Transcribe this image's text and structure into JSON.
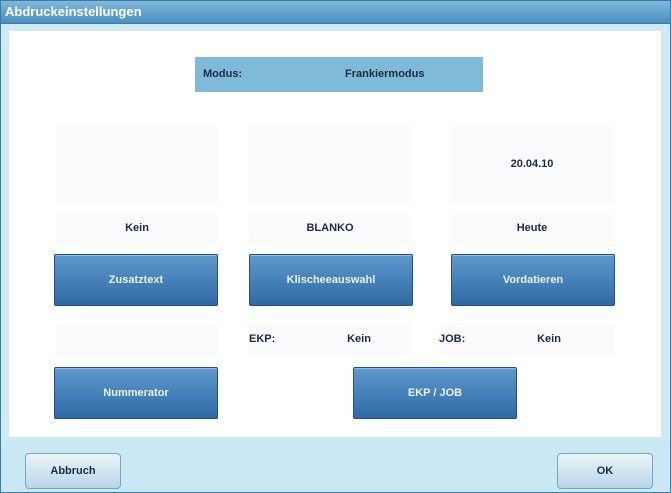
{
  "window": {
    "title": "Abdruckeinstellungen"
  },
  "modus": {
    "label": "Modus:",
    "value": "Frankiermodus"
  },
  "columns": [
    {
      "preview": "",
      "value": "Kein",
      "button": "Zusatztext"
    },
    {
      "preview": "",
      "value": "BLANKO",
      "button": "Klischeeauswahl"
    },
    {
      "preview": "20.04.10",
      "value": "Heute",
      "button": "Vordatieren"
    }
  ],
  "ekp": {
    "label": "EKP:",
    "value": "Kein"
  },
  "job": {
    "label": "JOB:",
    "value": "Kein"
  },
  "buttons": {
    "numerator": "Nummerator",
    "ekp_job": "EKP / JOB"
  },
  "footer": {
    "cancel": "Abbruch",
    "ok": "OK"
  },
  "colors": {
    "title_bar": "#4a8fc0",
    "button": "#3a78b4",
    "background": "#c9e8f3"
  }
}
